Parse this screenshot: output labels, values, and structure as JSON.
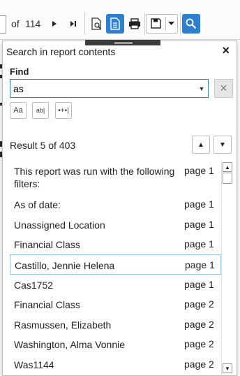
{
  "toolbar": {
    "of_label": "of",
    "page_count": "114"
  },
  "search_panel": {
    "title": "Search in report contents",
    "find_label": "Find",
    "query": "as",
    "options": {
      "match_case": "Aa",
      "whole_word": "ab|",
      "regex": "•+•|"
    },
    "result_summary": "Result 5 of 403",
    "results": [
      {
        "text": "This report was run with the following filters:",
        "page": "page 1"
      },
      {
        "text": "As of date:",
        "page": "page 1"
      },
      {
        "text": "Unassigned Location",
        "page": "page 1"
      },
      {
        "text": "Financial Class",
        "page": "page 1"
      },
      {
        "text": "Castillo, Jennie Helena",
        "page": "page 1",
        "selected": true
      },
      {
        "text": "Cas1752",
        "page": "page 1"
      },
      {
        "text": "Financial Class",
        "page": "page 2"
      },
      {
        "text": "Rasmussen, Elizabeth",
        "page": "page 2"
      },
      {
        "text": "Washington, Alma Vonnie",
        "page": "page 2"
      },
      {
        "text": "Was1144",
        "page": "page 2"
      }
    ]
  },
  "colors": {
    "accent": "#2f7fd0",
    "selected_border": "#9fc4ea"
  }
}
